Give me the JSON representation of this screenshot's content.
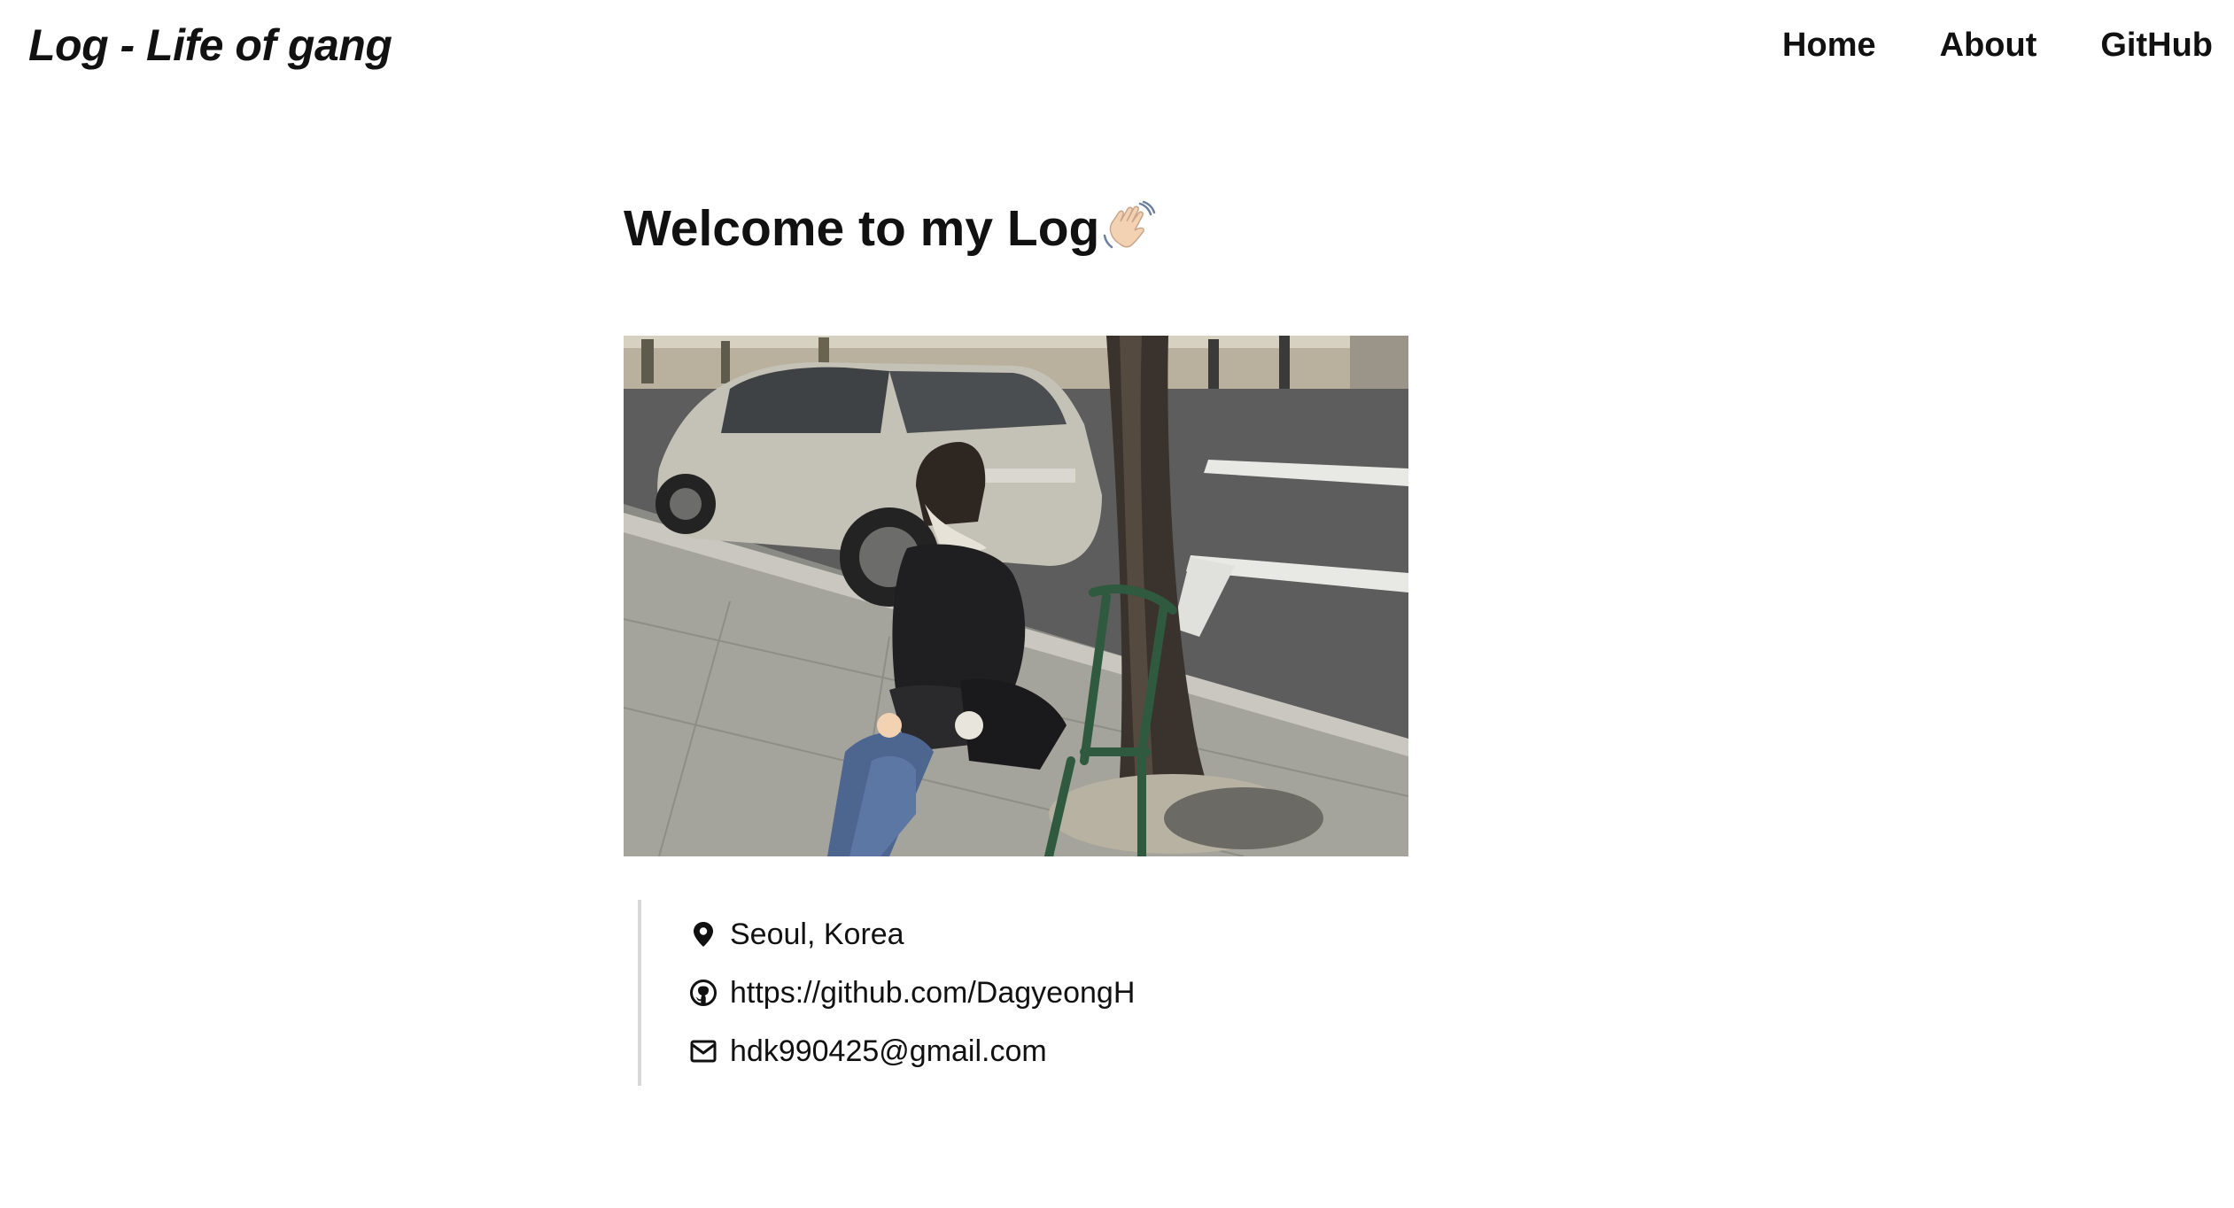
{
  "header": {
    "site_title": "Log - Life of gang",
    "nav": [
      {
        "label": "Home"
      },
      {
        "label": "About"
      },
      {
        "label": "GitHub"
      }
    ]
  },
  "main": {
    "title": "Welcome to my Log",
    "title_icon": "waving-hand-icon",
    "photo_icon": "profile-photo",
    "info": [
      {
        "icon": "map-pin-icon",
        "text": "Seoul, Korea"
      },
      {
        "icon": "github-icon",
        "text": "https://github.com/DagyeongH"
      },
      {
        "icon": "mail-icon",
        "text": "hdk990425@gmail.com"
      }
    ]
  },
  "colors": {
    "text": "#111111",
    "background": "#ffffff",
    "quote_border": "#d8d8d8"
  }
}
